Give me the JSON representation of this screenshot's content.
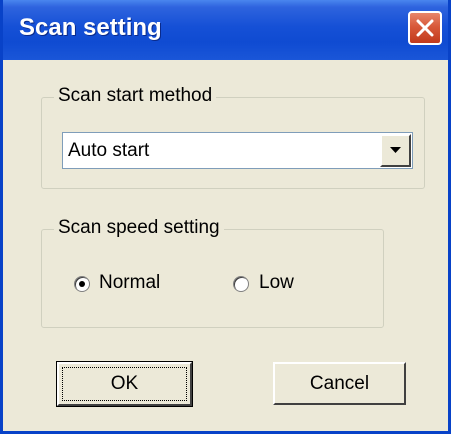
{
  "window": {
    "title": "Scan setting",
    "close_icon": "close-x-icon"
  },
  "scan_start": {
    "group_label": "Scan start method",
    "selected": "Auto start",
    "dropdown_icon": "chevron-down-icon"
  },
  "scan_speed": {
    "group_label": "Scan speed setting",
    "options": [
      {
        "label": "Normal",
        "selected": true
      },
      {
        "label": "Low",
        "selected": false
      }
    ]
  },
  "buttons": {
    "ok": "OK",
    "cancel": "Cancel"
  }
}
